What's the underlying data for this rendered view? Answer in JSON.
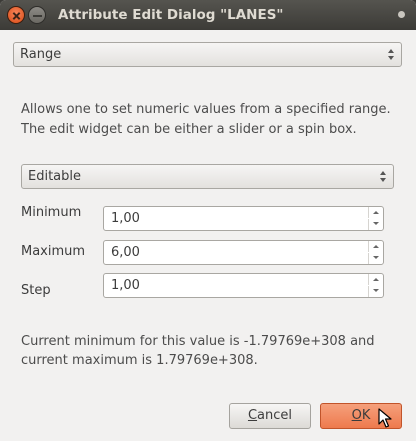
{
  "window": {
    "title": "Attribute Edit Dialog \"LANES\""
  },
  "widget_type": {
    "selected": "Range"
  },
  "description": "Allows one to set numeric values from a specified range. The edit widget can be either a slider or a spin box.",
  "mode": {
    "selected": "Editable"
  },
  "fields": {
    "minimum": {
      "label": "Minimum",
      "value": "1,00"
    },
    "maximum": {
      "label": "Maximum",
      "value": "6,00"
    },
    "step": {
      "label": "Step",
      "value": "1,00"
    }
  },
  "info_text": "Current minimum for this value is -1.79769e+308 and current maximum is 1.79769e+308.",
  "buttons": {
    "cancel": {
      "mnemonic": "C",
      "rest": "ancel"
    },
    "ok": {
      "mnemonic": "O",
      "rest": "K"
    }
  },
  "colors": {
    "titlebar": "#3c3b37",
    "accent": "#ee7a4d",
    "dialog_bg": "#f2f1f0"
  }
}
